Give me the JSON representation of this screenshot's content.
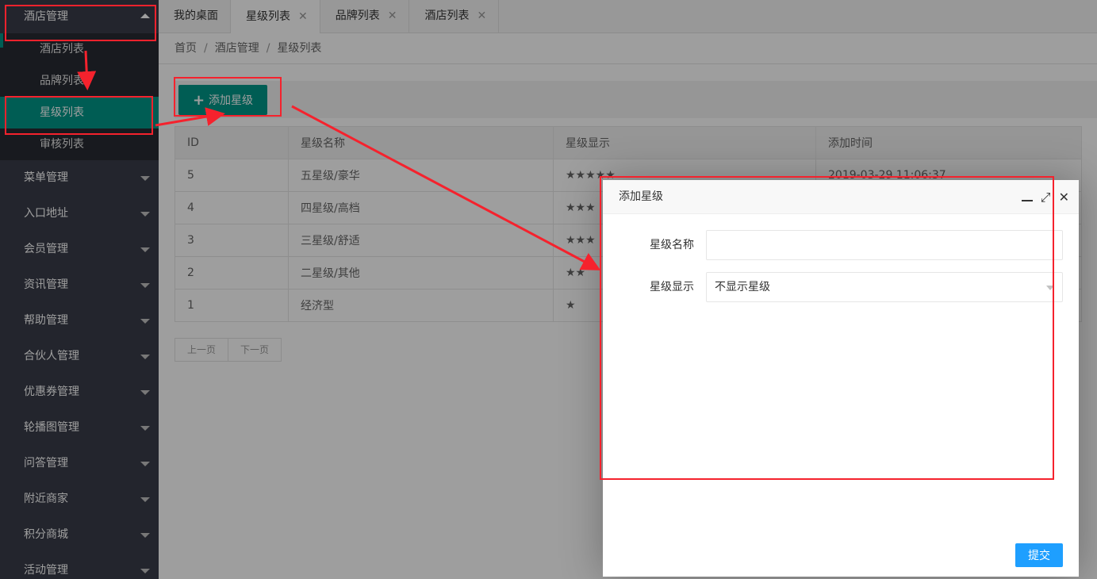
{
  "sidebar": {
    "open_group": "酒店管理",
    "sub_items": [
      {
        "label": "酒店列表"
      },
      {
        "label": "品牌列表"
      },
      {
        "label": "星级列表"
      },
      {
        "label": "审核列表"
      }
    ],
    "groups": [
      {
        "label": "菜单管理"
      },
      {
        "label": "入口地址"
      },
      {
        "label": "会员管理"
      },
      {
        "label": "资讯管理"
      },
      {
        "label": "帮助管理"
      },
      {
        "label": "合伙人管理"
      },
      {
        "label": "优惠券管理"
      },
      {
        "label": "轮播图管理"
      },
      {
        "label": "问答管理"
      },
      {
        "label": "附近商家"
      },
      {
        "label": "积分商城"
      },
      {
        "label": "活动管理"
      }
    ]
  },
  "tabs": [
    {
      "label": "我的桌面",
      "closable": false
    },
    {
      "label": "星级列表",
      "closable": true
    },
    {
      "label": "品牌列表",
      "closable": true
    },
    {
      "label": "酒店列表",
      "closable": true
    }
  ],
  "tab_close_glyph": "✕",
  "breadcrumb": {
    "items": [
      "首页",
      "酒店管理",
      "星级列表"
    ],
    "separator": "/"
  },
  "toolbar": {
    "add_label": "添加星级",
    "plus_glyph": "+"
  },
  "table": {
    "headers": [
      "ID",
      "星级名称",
      "星级显示",
      "添加时间"
    ],
    "rows": [
      {
        "id": "5",
        "name": "五星级/豪华",
        "stars": "★★★★★",
        "time": "2019-03-29 11:06:37"
      },
      {
        "id": "4",
        "name": "四星级/高档",
        "stars": "★★★",
        "time": ""
      },
      {
        "id": "3",
        "name": "三星级/舒适",
        "stars": "★★★",
        "time": ""
      },
      {
        "id": "2",
        "name": "二星级/其他",
        "stars": "★★",
        "time": ""
      },
      {
        "id": "1",
        "name": "经济型",
        "stars": "★",
        "time": ""
      }
    ]
  },
  "pager": {
    "prev": "上一页",
    "next": "下一页"
  },
  "dialog": {
    "title": "添加星级",
    "maximize_glyph": "⤢",
    "close_glyph": "✕",
    "name_label": "星级名称",
    "name_value": "",
    "display_label": "星级显示",
    "display_value": "不显示星级",
    "submit_label": "提交"
  },
  "colors": {
    "sidebar_bg": "#393D49",
    "accent": "#009688",
    "submit": "#1E9FFF",
    "annotation": "#f5222d"
  }
}
